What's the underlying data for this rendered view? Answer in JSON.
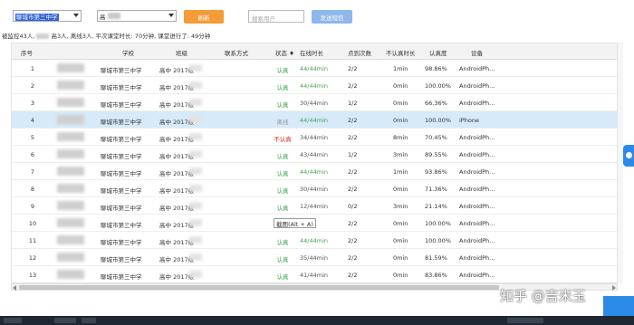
{
  "toolbar": {
    "school_select": "聊城市第三中学",
    "class_select": "高",
    "refresh_label": "刷新",
    "search_placeholder": "搜索用户",
    "send_label": "发送短信"
  },
  "summary": {
    "prefix": "被监控43人,",
    "mid1": "高3人,",
    "rest": "离线3人, 平次课堂时长: 70分钟, 课堂进行了: 49分钟"
  },
  "table": {
    "headers": {
      "index": "序号",
      "school": "学校",
      "class": "班级",
      "contact": "联系方式",
      "status": "状态",
      "online": "在线时长",
      "answers": "点到次数",
      "unsure": "不认真时长",
      "earnest": "认真度",
      "device": "设备"
    },
    "rows": [
      {
        "index": "1",
        "school": "聊城市第三中学",
        "class": "高中 2017级",
        "status": "认真",
        "status_color": "#3aa84a",
        "online": "44/44min",
        "answers": "2/2",
        "unsure": "1min",
        "earnest": "98.86%",
        "device": "AndroidPh..."
      },
      {
        "index": "2",
        "school": "聊城市第三中学",
        "class": "高中 2017级",
        "status": "认真",
        "status_color": "#3aa84a",
        "online": "44/44min",
        "answers": "2/2",
        "unsure": "0min",
        "earnest": "100.00%",
        "device": "AndroidPh..."
      },
      {
        "index": "3",
        "school": "聊城市第三中学",
        "class": "高中 2017级",
        "status": "认真",
        "status_color": "#3aa84a",
        "online": "30/44min",
        "answers": "1/2",
        "unsure": "0min",
        "earnest": "66.36%",
        "device": "AndroidPh..."
      },
      {
        "index": "4",
        "school": "聊城市第三中学",
        "class": "高中 2017级",
        "status": "离线",
        "status_color": "#9a9a9a",
        "online": "44/44min",
        "answers": "2/2",
        "unsure": "0min",
        "earnest": "100.00%",
        "device": "iPhone"
      },
      {
        "index": "5",
        "school": "聊城市第三中学",
        "class": "高中 2017级",
        "status": "不认真",
        "status_color": "#e0261d",
        "online": "34/44min",
        "answers": "2/2",
        "unsure": "8min",
        "earnest": "70.45%",
        "device": "AndroidPh..."
      },
      {
        "index": "6",
        "school": "聊城市第三中学",
        "class": "高中 2017级",
        "status": "认真",
        "status_color": "#3aa84a",
        "online": "43/44min",
        "answers": "1/2",
        "unsure": "3min",
        "earnest": "89.55%",
        "device": "AndroidPh..."
      },
      {
        "index": "7",
        "school": "聊城市第三中学",
        "class": "高中 2017级",
        "status": "认真",
        "status_color": "#3aa84a",
        "online": "44/44min",
        "answers": "2/2",
        "unsure": "1min",
        "earnest": "93.86%",
        "device": "AndroidPh..."
      },
      {
        "index": "8",
        "school": "聊城市第三中学",
        "class": "高中 2017级",
        "status": "认真",
        "status_color": "#3aa84a",
        "online": "30/44min",
        "answers": "2/2",
        "unsure": "0min",
        "earnest": "71.36%",
        "device": "AndroidPh..."
      },
      {
        "index": "9",
        "school": "聊城市第三中学",
        "class": "高中 2017级",
        "status": "认真",
        "status_color": "#3aa84a",
        "online": "12/44min",
        "answers": "0/2",
        "unsure": "3min",
        "earnest": "21.14%",
        "device": "AndroidPh..."
      },
      {
        "index": "10",
        "school": "聊城市第三中学",
        "class": "高中 2017级",
        "status": "截图(Alt + A)",
        "status_color": "#333333",
        "online": "",
        "answers": "2/2",
        "unsure": "0min",
        "earnest": "100.00%",
        "device": "AndroidPh..."
      },
      {
        "index": "11",
        "school": "聊城市第三中学",
        "class": "高中 2017级",
        "status": "认真",
        "status_color": "#3aa84a",
        "online": "44/44min",
        "answers": "2/2",
        "unsure": "0min",
        "earnest": "100.00%",
        "device": "AndroidPh..."
      },
      {
        "index": "12",
        "school": "聊城市第三中学",
        "class": "高中 2017级",
        "status": "认真",
        "status_color": "#3aa84a",
        "online": "35/44min",
        "answers": "2/2",
        "unsure": "0min",
        "earnest": "81.59%",
        "device": "AndroidPh..."
      },
      {
        "index": "13",
        "school": "聊城市第三中学",
        "class": "高中 2017级",
        "status": "认真",
        "status_color": "#3aa84a",
        "online": "41/44min",
        "answers": "2/2",
        "unsure": "0min",
        "earnest": "83.86%",
        "device": "AndroidPh..."
      }
    ]
  },
  "watermark": "知乎 @吉米玉"
}
